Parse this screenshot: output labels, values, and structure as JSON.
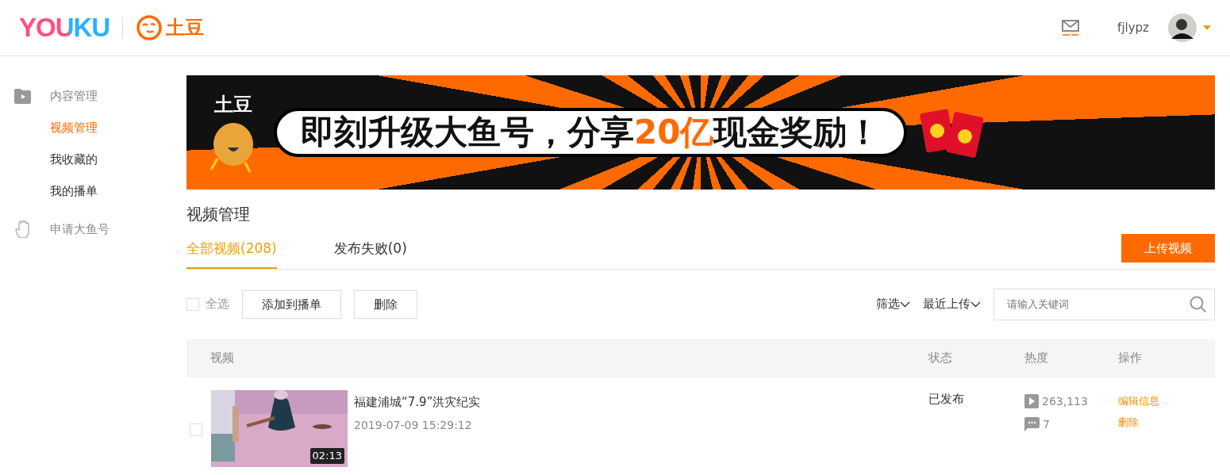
{
  "header": {
    "logo_youku": "YOUKU",
    "logo_tudou": "土豆",
    "username": "fjlypz"
  },
  "sidebar": {
    "items": [
      {
        "kind": "section",
        "label": "内容管理",
        "selected": false,
        "children": [
          {
            "kind": "link",
            "label": "视频管理",
            "selected": true
          },
          {
            "kind": "link",
            "label": "我收藏的",
            "selected": false
          },
          {
            "kind": "link",
            "label": "我的播单",
            "selected": false
          }
        ]
      },
      {
        "kind": "section",
        "label": "申请大鱼号",
        "selected": false
      }
    ]
  },
  "banner": {
    "logo_text": "土豆",
    "headline": "即刻升级大鱼号，分享",
    "highlight": "20亿",
    "headline_end": "现金奖励！"
  },
  "page_title": "视频管理",
  "tabs": [
    {
      "label": "全部视频(208)",
      "selected": true
    },
    {
      "label": "发布失败(0)",
      "selected": false
    }
  ],
  "upload_button": "上传视频",
  "toolbar": {
    "select_all": {
      "label": "全选",
      "checked": false
    },
    "buttons": [
      "添加到播单",
      "删除"
    ],
    "filters": [
      "筛选",
      "最近上传"
    ],
    "search": {
      "placeholder": "请输入关键词"
    }
  },
  "table": {
    "columns": [
      "视频",
      "状态",
      "热度",
      "操作"
    ],
    "rows": [
      {
        "checked": false,
        "duration": "02:13",
        "title": "福建浦城“7.9”洪灾纪实",
        "date": "2019-07-09 15:29:12",
        "status": "已发布",
        "plays": "263,113",
        "comments": "7",
        "actions": [
          "编辑信息",
          "删除"
        ]
      }
    ]
  }
}
